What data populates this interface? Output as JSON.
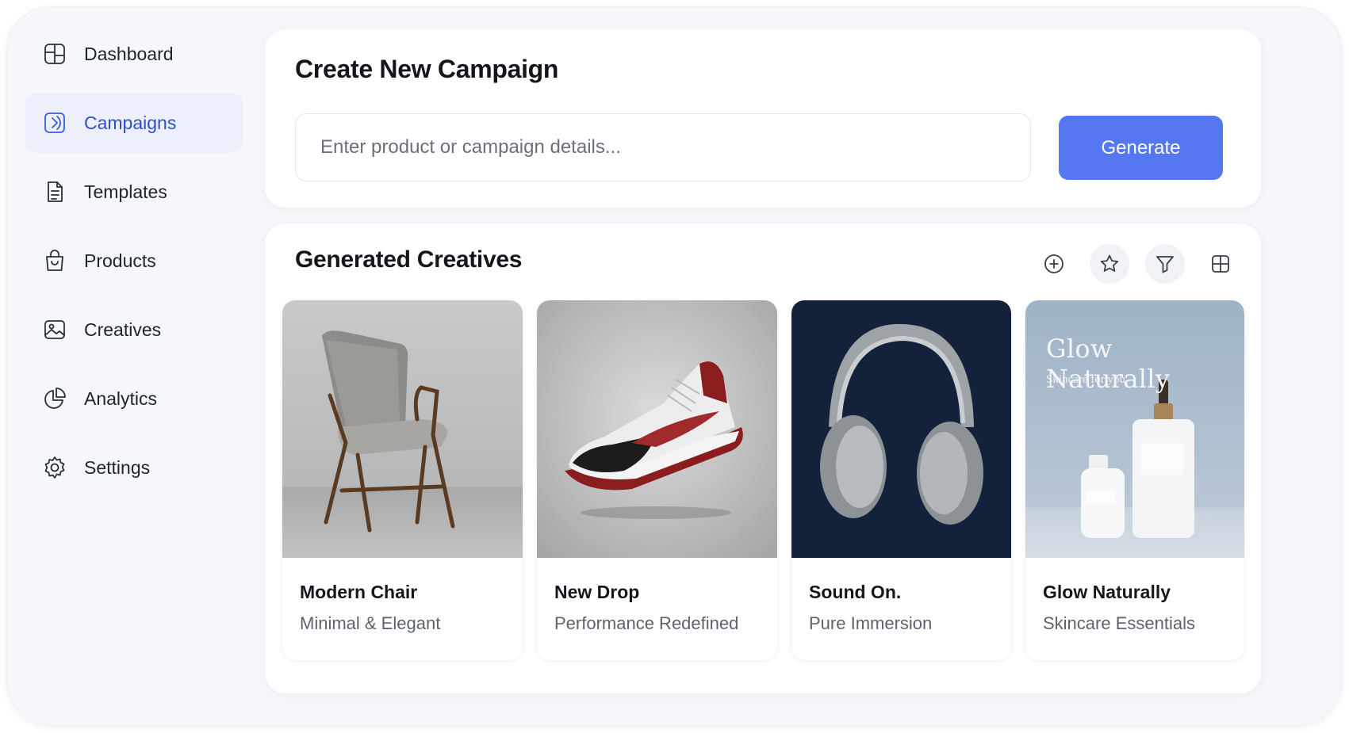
{
  "sidebar": {
    "items": [
      {
        "label": "Dashboard",
        "icon": "dashboard-icon",
        "active": false
      },
      {
        "label": "Campaigns",
        "icon": "campaign-icon",
        "active": true
      },
      {
        "label": "Templates",
        "icon": "document-icon",
        "active": false
      },
      {
        "label": "Products",
        "icon": "shopping-bag-icon",
        "active": false
      },
      {
        "label": "Creatives",
        "icon": "image-icon",
        "active": false
      },
      {
        "label": "Analytics",
        "icon": "pie-chart-icon",
        "active": false
      },
      {
        "label": "Settings",
        "icon": "gear-icon",
        "active": false
      }
    ]
  },
  "create_campaign": {
    "title": "Create New Campaign",
    "input_placeholder": "Enter product or campaign details...",
    "input_value": "",
    "generate_label": "Generate"
  },
  "creatives": {
    "title": "Generated Creatives",
    "toolbar": [
      "plus-circle-icon",
      "star-icon",
      "filter-icon",
      "grid-icon"
    ],
    "cards": [
      {
        "title": "Modern Chair",
        "subtitle": "Minimal & Elegant",
        "image": "chair-image"
      },
      {
        "title": "New Drop",
        "subtitle": "Performance Redefined",
        "image": "sneaker-image"
      },
      {
        "title": "Sound On.",
        "subtitle": "Pure Immersion",
        "image": "headphones-image"
      },
      {
        "title": "Glow Naturally",
        "subtitle": "Skincare Essentials",
        "image": "skincare-image",
        "overlay_title": "Glow Naturally",
        "overlay_subtitle": "Skincare for you."
      }
    ]
  },
  "colors": {
    "accent": "#5577f1",
    "active_nav_bg": "#edf0fa",
    "active_nav_text": "#2f4fc8",
    "page_bg": "#f6f7fa"
  }
}
